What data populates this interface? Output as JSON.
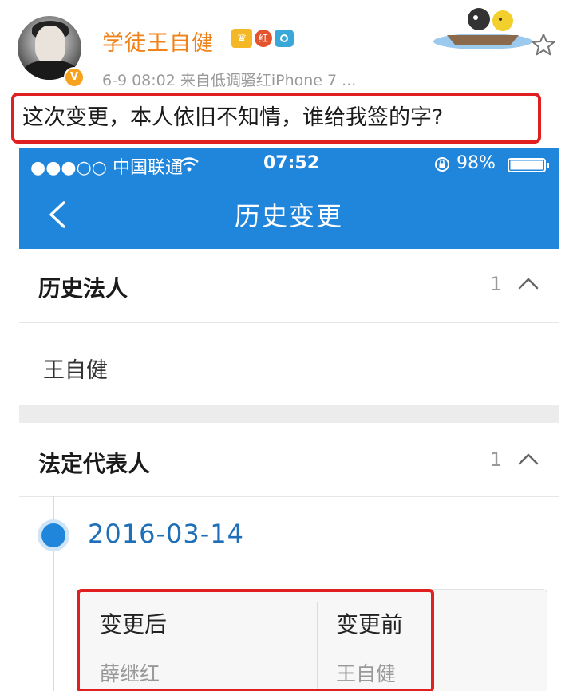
{
  "post": {
    "username": "学徒王自健",
    "badge_red_text": "红",
    "meta": "6-9 08:02  来自低调骚红iPhone 7 ...",
    "caption": "这次变更，本人依旧不知情，谁给我签的字?",
    "verified_badge": "V"
  },
  "phone": {
    "status_bar": {
      "carrier": "●●●○○ 中国联通",
      "time": "07:52",
      "battery": "98%"
    },
    "nav": {
      "title": "历史变更"
    },
    "sections": [
      {
        "label": "历史法人",
        "count": "1",
        "value": "王自健"
      },
      {
        "label": "法定代表人",
        "count": "1",
        "entry": {
          "date": "2016-03-14",
          "after_label": "变更后",
          "after_value": "薛继红",
          "before_label": "变更前",
          "before_value": "王自健"
        }
      }
    ]
  },
  "colors": {
    "accent": "#1f86dc",
    "username": "#f0821a",
    "highlight": "#e02020"
  }
}
